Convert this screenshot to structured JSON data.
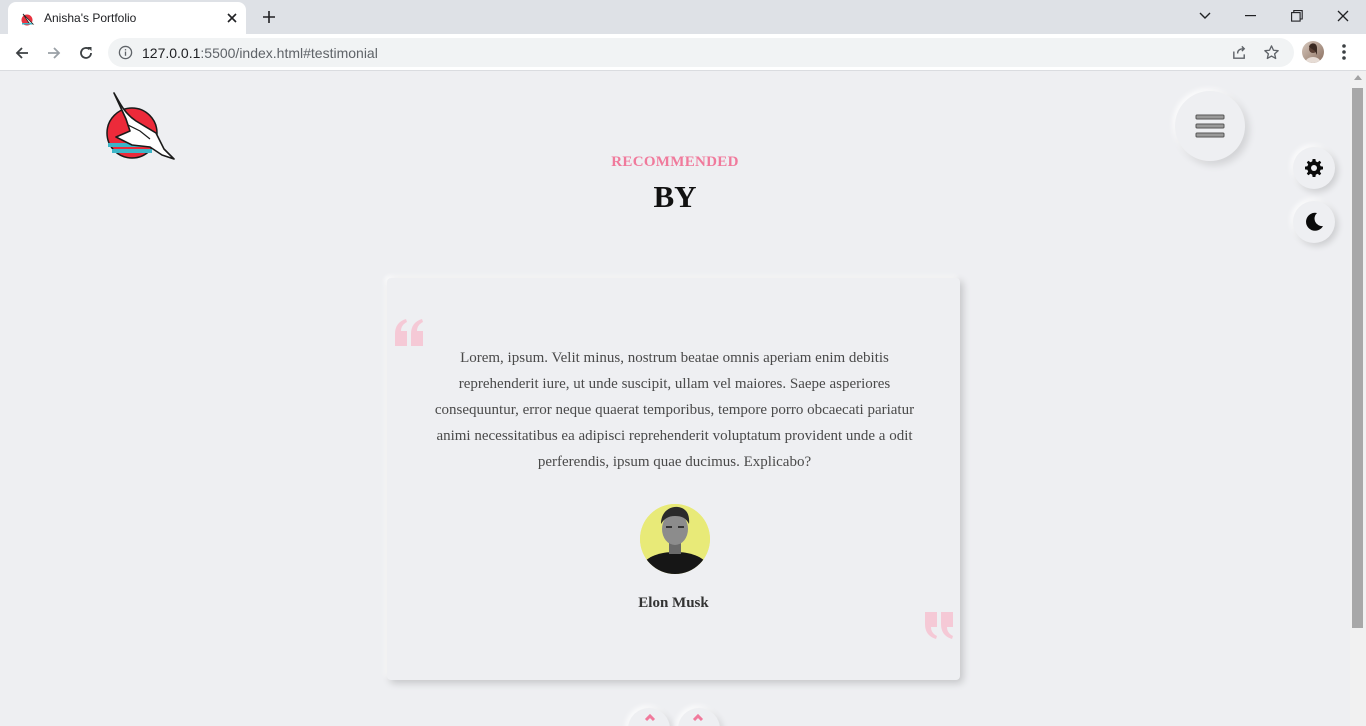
{
  "browser": {
    "tab_title": "Anisha's Portfolio",
    "url_host": "127.0.0.1",
    "url_rest": ":5500/index.html#testimonial",
    "icons": [
      "back-arrow-icon",
      "forward-arrow-icon",
      "reload-icon",
      "info-icon",
      "share-icon",
      "star-icon",
      "kebab-menu-icon",
      "minimize-icon",
      "restore-icon",
      "close-icon",
      "tab-dropdown-icon",
      "new-tab-icon"
    ]
  },
  "page": {
    "section": {
      "eyebrow": "RECOMMENDED",
      "heading": "BY"
    },
    "testimonial": {
      "text": "Lorem, ipsum. Velit minus, nostrum beatae omnis aperiam enim debitis reprehenderit iure, ut unde suscipit, ullam vel maiores. Saepe asperiores consequuntur, error neque quaerat temporibus, tempore porro obcaecati pariatur animi necessitatibus ea adipisci reprehenderit voluptatum provident unde a odit perferendis, ipsum quae ducimus. Explicabo?",
      "name": "Elon Musk"
    },
    "controls": {
      "menu_icon": "hamburger-icon",
      "settings_icon": "gear-icon",
      "theme_icon": "moon-icon"
    },
    "colors": {
      "accent": "#f07a9c",
      "background": "#eeeff2",
      "quote_mark": "#f5c9d6",
      "avatar_bg": "#e8ea78"
    }
  }
}
